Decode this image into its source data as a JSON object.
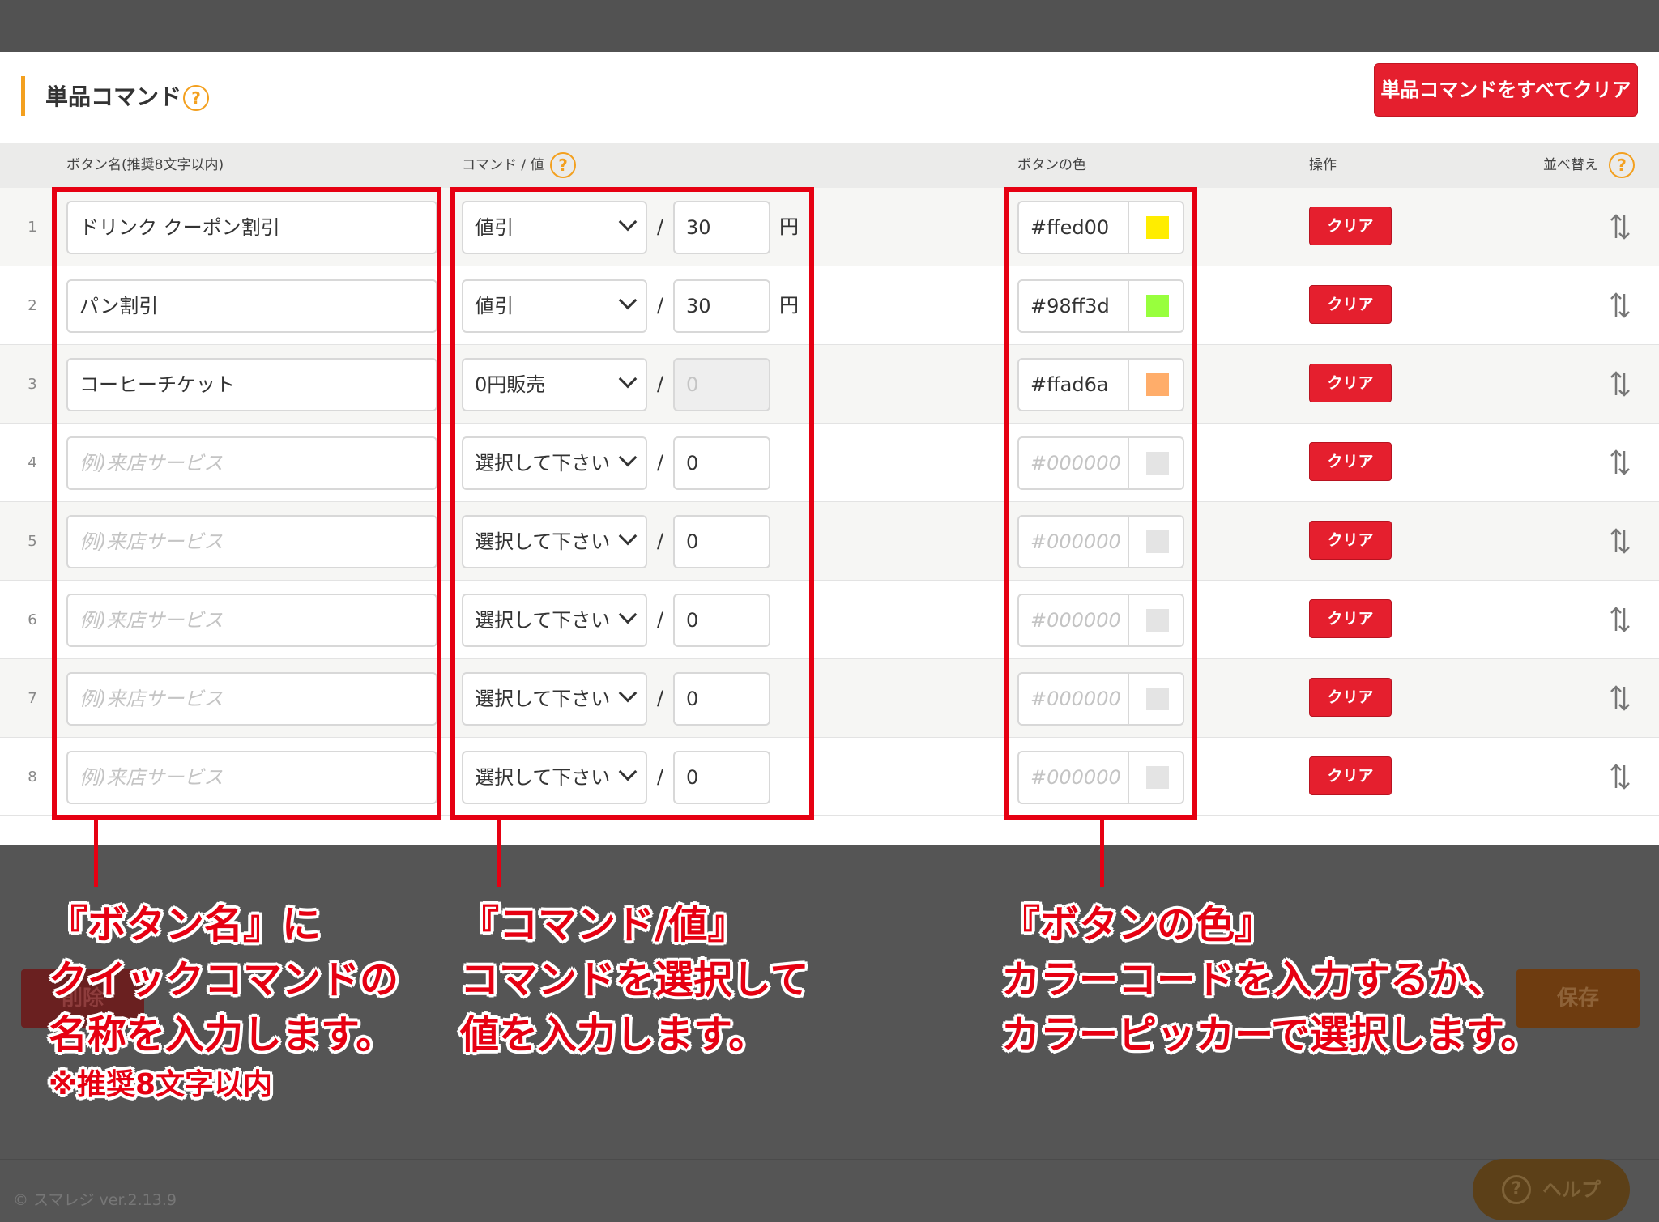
{
  "section": {
    "title": "単品コマンド",
    "help_icon": "question-circle-icon",
    "clear_all_label": "単品コマンドをすべてクリア"
  },
  "table": {
    "headers": {
      "name": "ボタン名(推奨8文字以内)",
      "command": "コマンド / 値",
      "color": "ボタンの色",
      "action": "操作",
      "sort": "並べ替え"
    },
    "clear_label": "クリア",
    "name_placeholder": "例)来店サービス",
    "color_placeholder": "#000000",
    "rows": [
      {
        "no": "1",
        "name": "ドリンク クーポン割引",
        "command": "値引",
        "value": "30",
        "unit": "円",
        "color": "#ffed00",
        "swatch": "#ffed00",
        "value_disabled": false
      },
      {
        "no": "2",
        "name": "パン割引",
        "command": "値引",
        "value": "30",
        "unit": "円",
        "color": "#98ff3d",
        "swatch": "#98ff3d",
        "value_disabled": false
      },
      {
        "no": "3",
        "name": "コーヒーチケット",
        "command": "0円販売",
        "value": "0",
        "unit": "",
        "color": "#ffad6a",
        "swatch": "#ffad6a",
        "value_disabled": true
      },
      {
        "no": "4",
        "name": "",
        "command": "選択して下さい",
        "value": "0",
        "unit": "",
        "color": "",
        "swatch": "#e4e4e4",
        "value_disabled": false
      },
      {
        "no": "5",
        "name": "",
        "command": "選択して下さい",
        "value": "0",
        "unit": "",
        "color": "",
        "swatch": "#e4e4e4",
        "value_disabled": false
      },
      {
        "no": "6",
        "name": "",
        "command": "選択して下さい",
        "value": "0",
        "unit": "",
        "color": "",
        "swatch": "#e4e4e4",
        "value_disabled": false
      },
      {
        "no": "7",
        "name": "",
        "command": "選択して下さい",
        "value": "0",
        "unit": "",
        "color": "",
        "swatch": "#e4e4e4",
        "value_disabled": false
      },
      {
        "no": "8",
        "name": "",
        "command": "選択して下さい",
        "value": "0",
        "unit": "",
        "color": "",
        "swatch": "#e4e4e4",
        "value_disabled": false
      }
    ]
  },
  "annotations": {
    "name": {
      "lines": [
        "『ボタン名』に",
        "クイックコマンドの",
        "名称を入力します。"
      ],
      "note": "※推奨8文字以内"
    },
    "command": {
      "lines": [
        "『コマンド/値』",
        "コマンドを選択して",
        "値を入力します。"
      ]
    },
    "color": {
      "lines": [
        "『ボタンの色』",
        "カラーコードを入力するか、",
        "カラーピッカーで選択します。"
      ]
    }
  },
  "background": {
    "delete_label": "削除",
    "save_label": "保存",
    "help_label": "ヘルプ",
    "footer": "© スマレジ ver.2.13.9"
  },
  "colors": {
    "accent_orange": "#f3a01f",
    "danger_red": "#e51f2e",
    "annotation_red": "#e60012"
  }
}
